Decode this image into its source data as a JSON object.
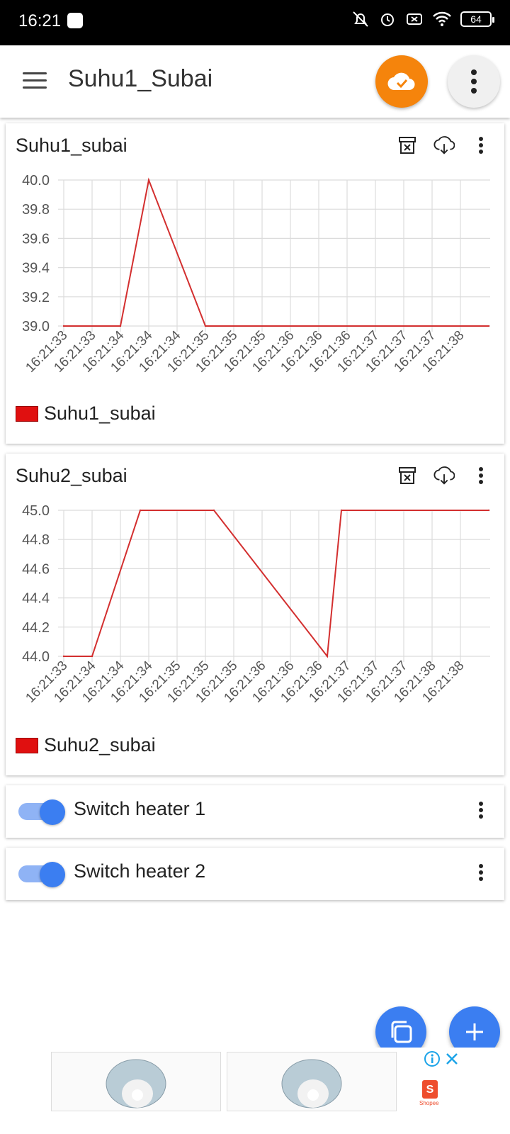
{
  "status_bar": {
    "time": "16:21",
    "battery": "64"
  },
  "app_bar": {
    "title": "Suhu1_Subai"
  },
  "charts": [
    {
      "title": "Suhu1_subai",
      "legend": "Suhu1_subai",
      "line_color": "#d32f2f",
      "x_ticks": [
        "16:21:33",
        "16:21:33",
        "16:21:34",
        "16:21:34",
        "16:21:34",
        "16:21:35",
        "16:21:35",
        "16:21:35",
        "16:21:36",
        "16:21:36",
        "16:21:36",
        "16:21:37",
        "16:21:37",
        "16:21:37",
        "16:21:38"
      ],
      "y_ticks": [
        "40.0",
        "39.8",
        "39.6",
        "39.4",
        "39.2",
        "39.0"
      ]
    },
    {
      "title": "Suhu2_subai",
      "legend": "Suhu2_subai",
      "line_color": "#d32f2f",
      "x_ticks": [
        "16:21:33",
        "16:21:34",
        "16:21:34",
        "16:21:34",
        "16:21:35",
        "16:21:35",
        "16:21:35",
        "16:21:36",
        "16:21:36",
        "16:21:36",
        "16:21:37",
        "16:21:37",
        "16:21:37",
        "16:21:38",
        "16:21:38"
      ],
      "y_ticks": [
        "45.0",
        "44.8",
        "44.6",
        "44.4",
        "44.2",
        "44.0"
      ]
    }
  ],
  "chart_data": [
    {
      "type": "line",
      "title": "Suhu1_subai",
      "ylim": [
        39.0,
        40.0
      ],
      "series": [
        {
          "name": "Suhu1_subai",
          "x": [
            0,
            2,
            3,
            5,
            15
          ],
          "values": [
            39.0,
            39.0,
            40.0,
            39.0,
            39.0
          ]
        }
      ]
    },
    {
      "type": "line",
      "title": "Suhu2_subai",
      "ylim": [
        44.0,
        45.0
      ],
      "series": [
        {
          "name": "Suhu2_subai",
          "x": [
            0,
            1,
            2.7,
            5.3,
            9.3,
            9.8,
            15
          ],
          "values": [
            44.0,
            44.0,
            45.0,
            45.0,
            44.0,
            45.0,
            45.0
          ]
        }
      ]
    }
  ],
  "switches": [
    {
      "label": "Switch heater 1",
      "on": true
    },
    {
      "label": "Switch heater 2",
      "on": true
    }
  ],
  "ad": {
    "sponsor": "Shopee"
  }
}
